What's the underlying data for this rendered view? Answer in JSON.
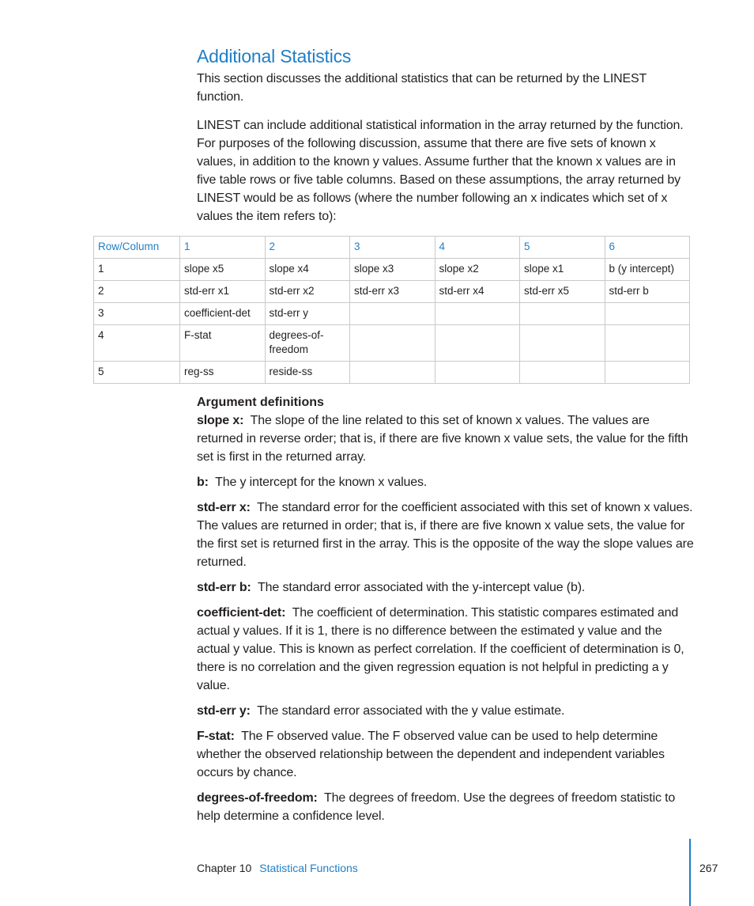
{
  "section": {
    "title": "Additional Statistics",
    "intro": "This section discusses the additional statistics that can be returned by the LINEST function.",
    "paragraph": "LINEST can include additional statistical information in the array returned by the function. For purposes of the following discussion, assume that there are five sets of known x values, in addition to the known y values. Assume further that the known x values are in five table rows or five table columns. Based on these assumptions, the array returned by LINEST would be as follows (where the number following an x indicates which set of x values the item refers to):"
  },
  "table": {
    "headers": [
      "Row/Column",
      "1",
      "2",
      "3",
      "4",
      "5",
      "6"
    ],
    "rows": [
      [
        "1",
        "slope x5",
        "slope x4",
        "slope x3",
        "slope x2",
        "slope x1",
        "b (y intercept)"
      ],
      [
        "2",
        "std-err x1",
        "std-err x2",
        "std-err x3",
        "std-err x4",
        "std-err x5",
        "std-err b"
      ],
      [
        "3",
        "coefficient-det",
        "std-err y",
        "",
        "",
        "",
        ""
      ],
      [
        "4",
        "F-stat",
        "degrees-of-freedom",
        "",
        "",
        "",
        ""
      ],
      [
        "5",
        "reg-ss",
        "reside-ss",
        "",
        "",
        "",
        ""
      ]
    ]
  },
  "definitions": {
    "heading": "Argument definitions",
    "items": [
      {
        "term": "slope x:",
        "text": "The slope of the line related to this set of known x values. The values are returned in reverse order; that is, if there are five known x value sets, the value for the fifth set is first in the returned array."
      },
      {
        "term": "b:",
        "text": "The y intercept for the known x values."
      },
      {
        "term": "std-err x:",
        "text": "The standard error for the coefficient associated with this set of known x values. The values are returned in order; that is, if there are five known x value sets, the value for the first set is returned first in the array. This is the opposite of the way the slope values are returned."
      },
      {
        "term": "std-err b:",
        "text": "The standard error associated with the y-intercept value (b)."
      },
      {
        "term": "coefficient-det:",
        "text": "The coefficient of determination. This statistic compares estimated and actual y values. If it is 1, there is no difference between the estimated y value and the actual y value. This is known as perfect correlation. If the coefficient of determination is 0, there is no correlation and the given regression equation is not helpful in predicting a y value."
      },
      {
        "term": "std-err y:",
        "text": "The standard error associated with the y value estimate."
      },
      {
        "term": "F-stat:",
        "text": "The F observed value. The F observed value can be used to help determine whether the observed relationship between the dependent and independent variables occurs by chance."
      },
      {
        "term": "degrees-of-freedom:",
        "text": "The degrees of freedom. Use the degrees of freedom statistic to help determine a confidence level."
      }
    ]
  },
  "footer": {
    "chapter_label": "Chapter 10",
    "chapter_title": "Statistical Functions",
    "page_number": "267"
  }
}
